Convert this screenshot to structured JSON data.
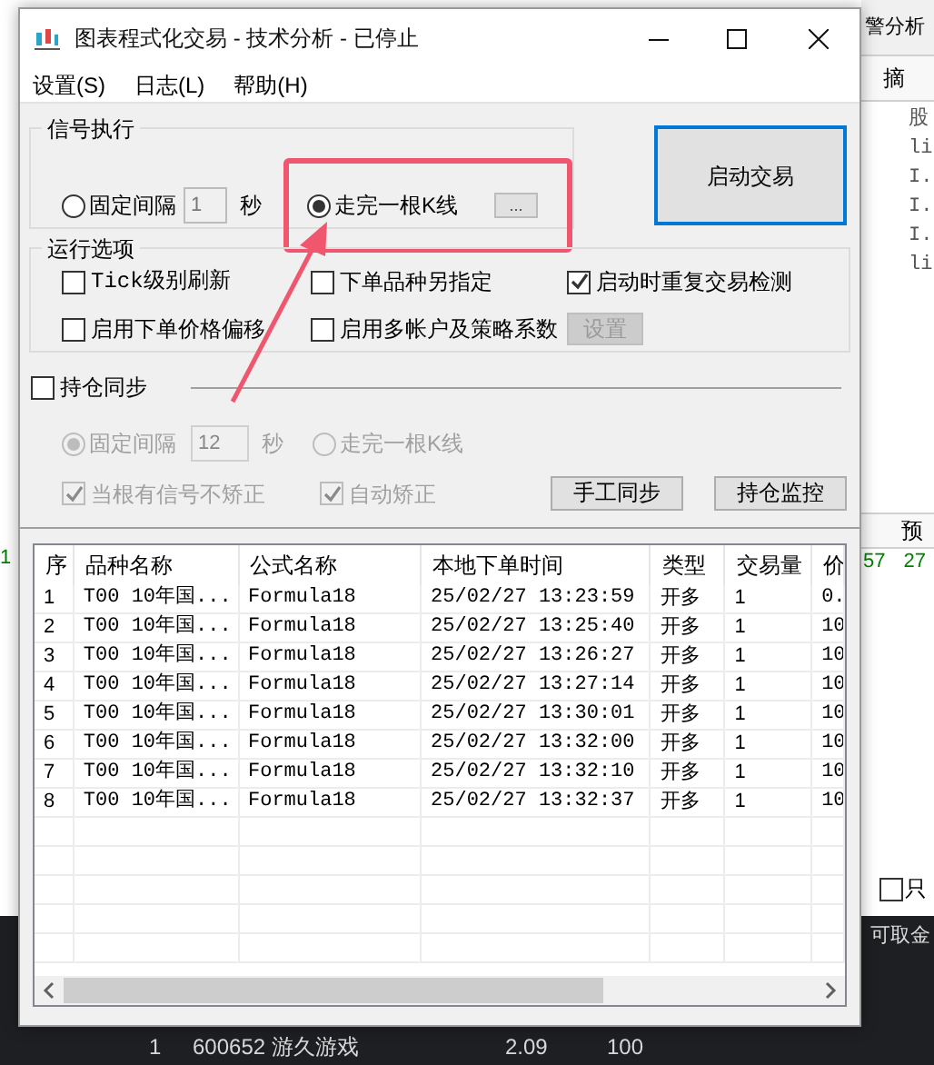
{
  "window": {
    "title": "图表程式化交易 - 技术分析 - 已停止"
  },
  "menu": [
    {
      "label": "设置(S)"
    },
    {
      "label": "日志(L)"
    },
    {
      "label": "帮助(H)"
    }
  ],
  "signal": {
    "title": "信号执行",
    "options": [
      {
        "label": "固定间隔",
        "selected": false
      },
      {
        "label": "走完一根K线",
        "selected": true
      }
    ],
    "interval": "1",
    "unit": "秒",
    "more_button": "...",
    "highlighted": true
  },
  "start_button": "启动交易",
  "run_options": {
    "title": "运行选项",
    "items": [
      {
        "label": "Tick级别刷新",
        "checked": false
      },
      {
        "label": "下单品种另指定",
        "checked": false
      },
      {
        "label": "启动时重复交易检测",
        "checked": true
      },
      {
        "label": "启用下单价格偏移",
        "checked": false
      },
      {
        "label": "启用多帐户及策略系数",
        "checked": false
      }
    ],
    "settings_button": {
      "label": "设置",
      "disabled": true
    }
  },
  "position_sync": {
    "label": "持仓同步",
    "checked": false,
    "disabled": true,
    "options": [
      {
        "label": "固定间隔",
        "selected": true
      },
      {
        "label": "走完一根K线",
        "selected": false
      }
    ],
    "interval": "12",
    "unit": "秒",
    "checks": [
      {
        "label": "当根有信号不矫正",
        "checked": true
      },
      {
        "label": "自动矫正",
        "checked": true
      }
    ],
    "buttons": [
      "手工同步",
      "持仓监控"
    ]
  },
  "table": {
    "columns": [
      "序",
      "品种名称",
      "公式名称",
      "本地下单时间",
      "类型",
      "交易量",
      "价"
    ],
    "rows": [
      [
        "1",
        "T00 10年国...",
        "Formula18",
        "25/02/27 13:23:59",
        "开多",
        "1",
        "0."
      ],
      [
        "2",
        "T00 10年国...",
        "Formula18",
        "25/02/27 13:25:40",
        "开多",
        "1",
        "10"
      ],
      [
        "3",
        "T00 10年国...",
        "Formula18",
        "25/02/27 13:26:27",
        "开多",
        "1",
        "10"
      ],
      [
        "4",
        "T00 10年国...",
        "Formula18",
        "25/02/27 13:27:14",
        "开多",
        "1",
        "10"
      ],
      [
        "5",
        "T00 10年国...",
        "Formula18",
        "25/02/27 13:30:01",
        "开多",
        "1",
        "10"
      ],
      [
        "6",
        "T00 10年国...",
        "Formula18",
        "25/02/27 13:32:00",
        "开多",
        "1",
        "10"
      ],
      [
        "7",
        "T00 10年国...",
        "Formula18",
        "25/02/27 13:32:10",
        "开多",
        "1",
        "10"
      ],
      [
        "8",
        "T00 10年国...",
        "Formula18",
        "25/02/27 13:32:37",
        "开多",
        "1",
        "10"
      ]
    ]
  },
  "background": {
    "top_right": "警分析",
    "header_right": "摘",
    "right_column": [
      "股",
      "li",
      "I.",
      "I.",
      "I.",
      "li"
    ],
    "lower_header_right": "预",
    "left_row_index": "1",
    "right_row_values": [
      "57",
      "27"
    ],
    "checkbox_label": "只",
    "checkbox_checked": false,
    "bottom_label": "可取金",
    "bottom_row": [
      "1",
      "600652 游久游戏",
      "2.09",
      "100"
    ]
  }
}
